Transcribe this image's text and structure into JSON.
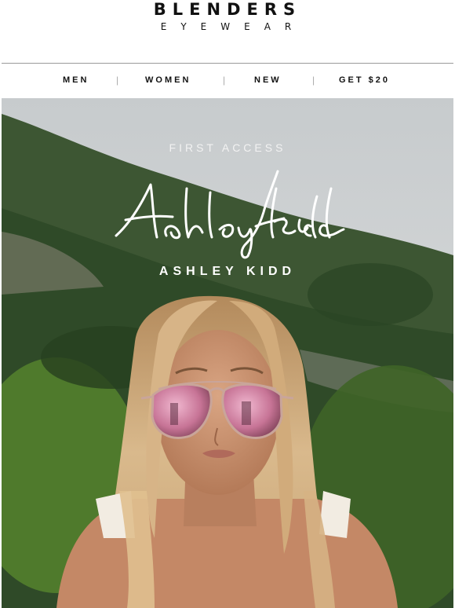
{
  "brand": {
    "name": "BLENDERS",
    "subtitle": "EYEWEAR"
  },
  "nav": {
    "items": [
      {
        "label": "MEN"
      },
      {
        "label": "WOMEN"
      },
      {
        "label": "NEW"
      },
      {
        "label": "GET $20"
      }
    ],
    "separator": "|"
  },
  "hero": {
    "kicker": "FIRST ACCESS",
    "signature_text": "Ashley Kidd",
    "name": "ASHLEY KIDD",
    "image_description_icon": "woman-in-pink-mirrored-aviator-sunglasses"
  },
  "colors": {
    "text": "#111111",
    "divider": "#9a9a9a",
    "hero_text": "#ffffff",
    "lens_pink": "#d88aa8",
    "frame_rose_gold": "#c9a59a"
  }
}
